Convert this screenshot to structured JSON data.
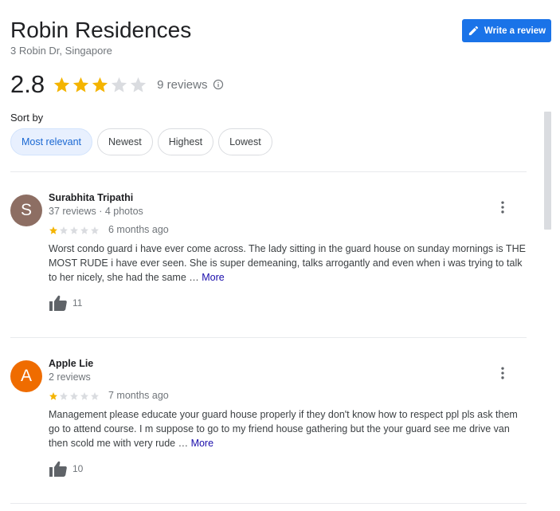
{
  "place": {
    "name": "Robin Residences",
    "address": "3 Robin Dr, Singapore"
  },
  "actions": {
    "write_review_label": "Write a review"
  },
  "rating": {
    "average": "2.8",
    "stars_filled": 3,
    "stars_total": 5,
    "reviews_count": "9 reviews"
  },
  "sort": {
    "label": "Sort by",
    "options": [
      "Most relevant",
      "Newest",
      "Highest",
      "Lowest"
    ],
    "selected": "Most relevant"
  },
  "icons": {
    "write": "pencil-icon",
    "info": "info-icon",
    "more": "more-vert-icon",
    "like": "thumbs-up-icon",
    "star": "star-icon"
  },
  "colors": {
    "star_filled": "#f4b400",
    "star_empty": "#dadce0",
    "accent": "#1a73e8",
    "link": "#1a0dab"
  },
  "reviews": [
    {
      "initial": "S",
      "avatar_color": "#8d6e63",
      "name": "Surabhita Tripathi",
      "meta": "37 reviews · 4 photos",
      "stars": 1,
      "date": "6 months ago",
      "text": "Worst condo guard i have ever come across. The lady sitting in the guard house on sunday mornings is THE MOST RUDE i have ever seen. She is super demeaning, talks arrogantly and even when i was trying to talk to her nicely, she had the same …",
      "more_label": "More",
      "likes": "11"
    },
    {
      "initial": "A",
      "avatar_color": "#ef6c00",
      "name": "Apple Lie",
      "meta": "2 reviews",
      "stars": 1,
      "date": "7 months ago",
      "text": "Management please educate your guard house properly if they don't know how to respect ppl pls ask them go to attend course. I m suppose to go to my friend house gathering but the your guard see me drive van then scold me with very rude …",
      "more_label": "More",
      "likes": "10"
    }
  ]
}
